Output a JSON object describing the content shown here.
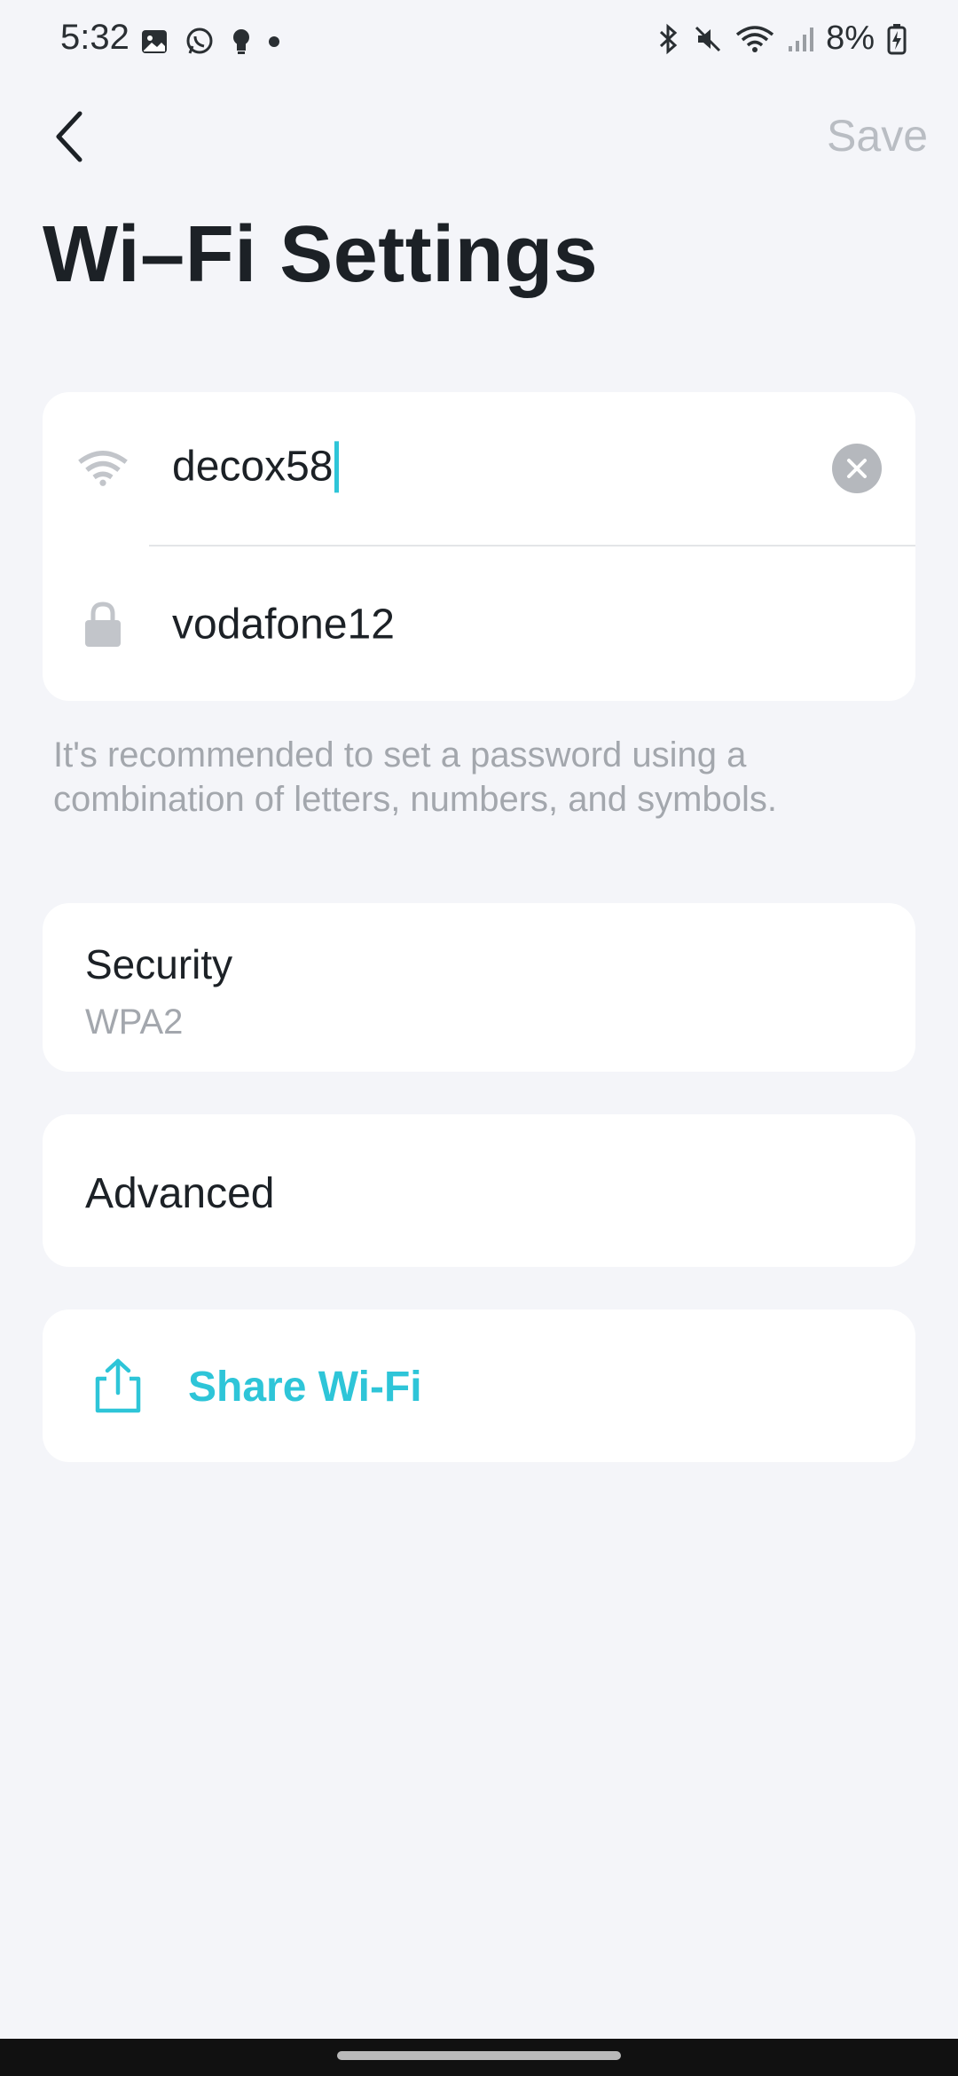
{
  "status_bar": {
    "time": "5:32",
    "battery_text": "8%",
    "left_icons": [
      "gallery-icon",
      "whatsapp-icon",
      "bulb-icon",
      "dot-icon"
    ],
    "right_icons": [
      "bluetooth-icon",
      "mute-icon",
      "wifi-icon",
      "signal-icon",
      "battery-icon"
    ]
  },
  "header": {
    "back_icon": "chevron-left-icon",
    "save_label": "Save",
    "title": "Wi–Fi Settings"
  },
  "network": {
    "ssid_value": "decox58",
    "ssid_icon": "wifi-icon",
    "clear_icon": "clear-icon",
    "password_value": "vodafone12",
    "password_icon": "lock-icon"
  },
  "hint": "It's recommended to set a password using a combination of letters, numbers, and symbols.",
  "security": {
    "label": "Security",
    "value": "WPA2"
  },
  "advanced": {
    "label": "Advanced"
  },
  "share": {
    "label": "Share Wi-Fi",
    "icon": "share-icon"
  },
  "colors": {
    "accent": "#2ec5d8",
    "background": "#f4f5f9",
    "card": "#ffffff",
    "muted_text": "#a3a7ad"
  }
}
